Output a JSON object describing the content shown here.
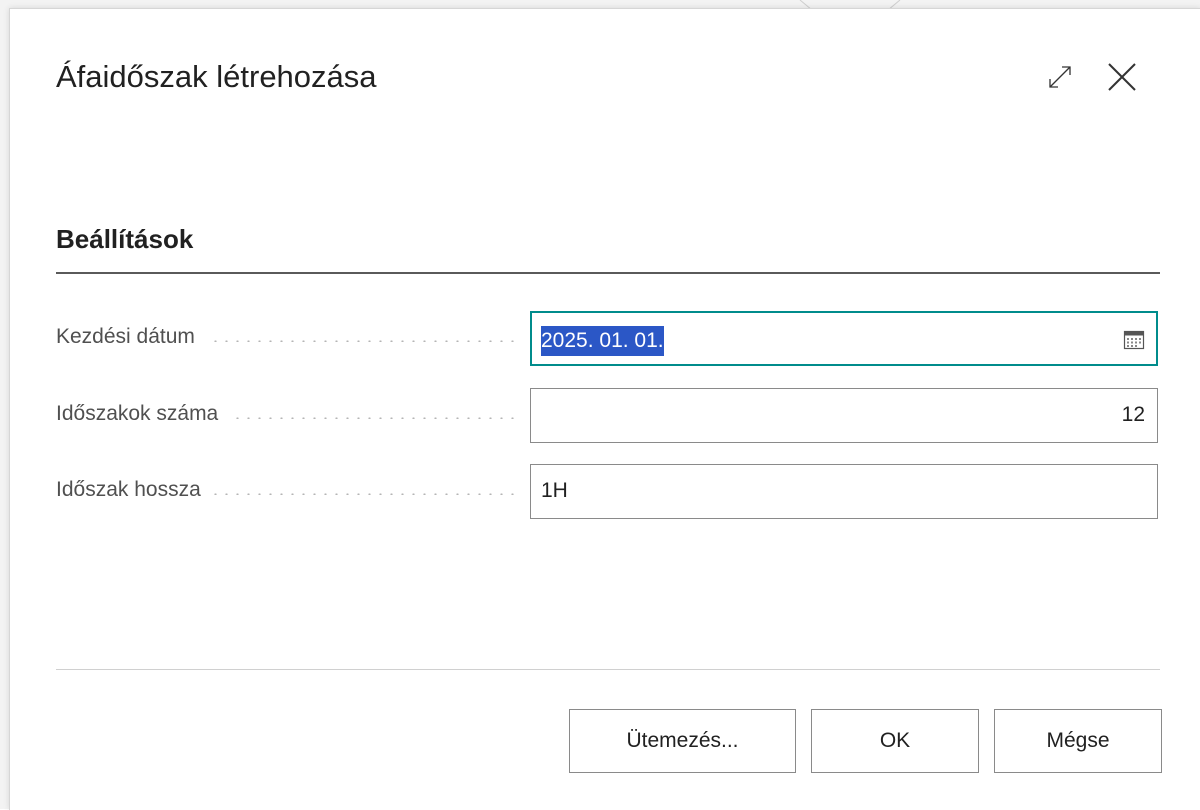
{
  "dialog": {
    "title": "Áfaidőszak létrehozása"
  },
  "section": {
    "title": "Beállítások"
  },
  "fields": [
    {
      "label": "Kezdési dátum",
      "value": "2025. 01. 01."
    },
    {
      "label": "Időszakok száma",
      "value": "12"
    },
    {
      "label": "Időszak hossza",
      "value": "1H"
    }
  ],
  "buttons": {
    "schedule": "Ütemezés...",
    "ok": "OK",
    "cancel": "Mégse"
  },
  "icons": {
    "expand": "expand-icon",
    "close": "close-icon",
    "calendar": "calendar-icon"
  },
  "colors": {
    "focus_border": "#008c8c",
    "selection": "#2b57c6"
  }
}
